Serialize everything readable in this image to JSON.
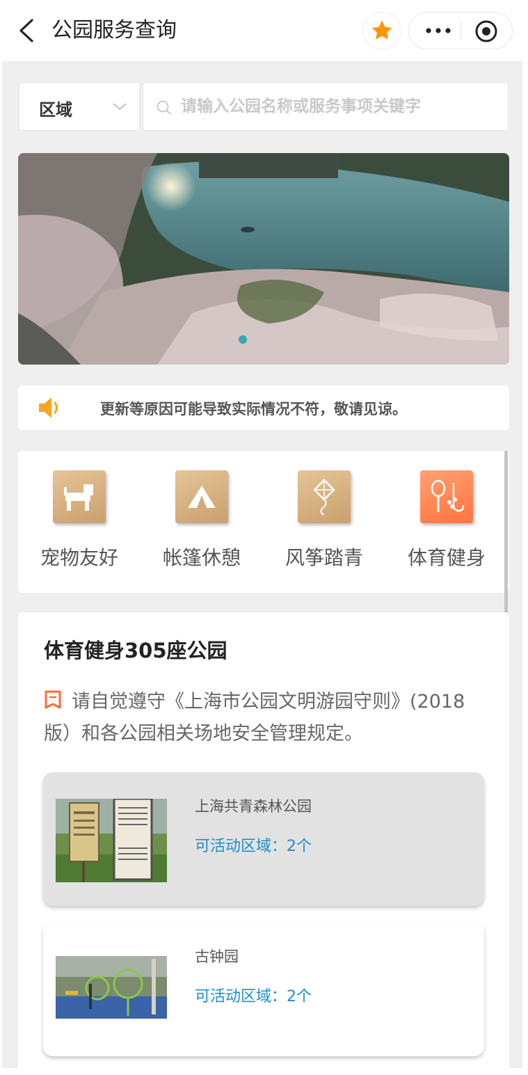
{
  "nav": {
    "title": "公园服务查询"
  },
  "search": {
    "region_label": "区域",
    "placeholder": "请输入公园名称或服务事项关键字"
  },
  "notice": {
    "text": "更新等原因可能导致实际情况不符，敬请见谅。",
    "icon": "speaker-icon"
  },
  "categories": [
    {
      "label": "宠物友好",
      "icon": "dog-icon"
    },
    {
      "label": "帐篷休憩",
      "icon": "tent-icon"
    },
    {
      "label": "风筝踏青",
      "icon": "kite-icon"
    },
    {
      "label": "体育健身",
      "icon": "sports-icon"
    }
  ],
  "panel": {
    "title": "体育健身305座公园",
    "rules": "请自觉遵守《上海市公园文明游园守则》(2018版）和各公园相关场地安全管理规定。"
  },
  "parks": [
    {
      "name": "上海共青森林公园",
      "areas": "可活动区域：2个"
    },
    {
      "name": "古钟园",
      "areas": "可活动区域：2个"
    }
  ],
  "colors": {
    "accent_blue": "#1e8ec8",
    "star_orange": "#ff9500",
    "category_gold": "#d4ad7c",
    "category_orange": "#ff7f4a"
  }
}
